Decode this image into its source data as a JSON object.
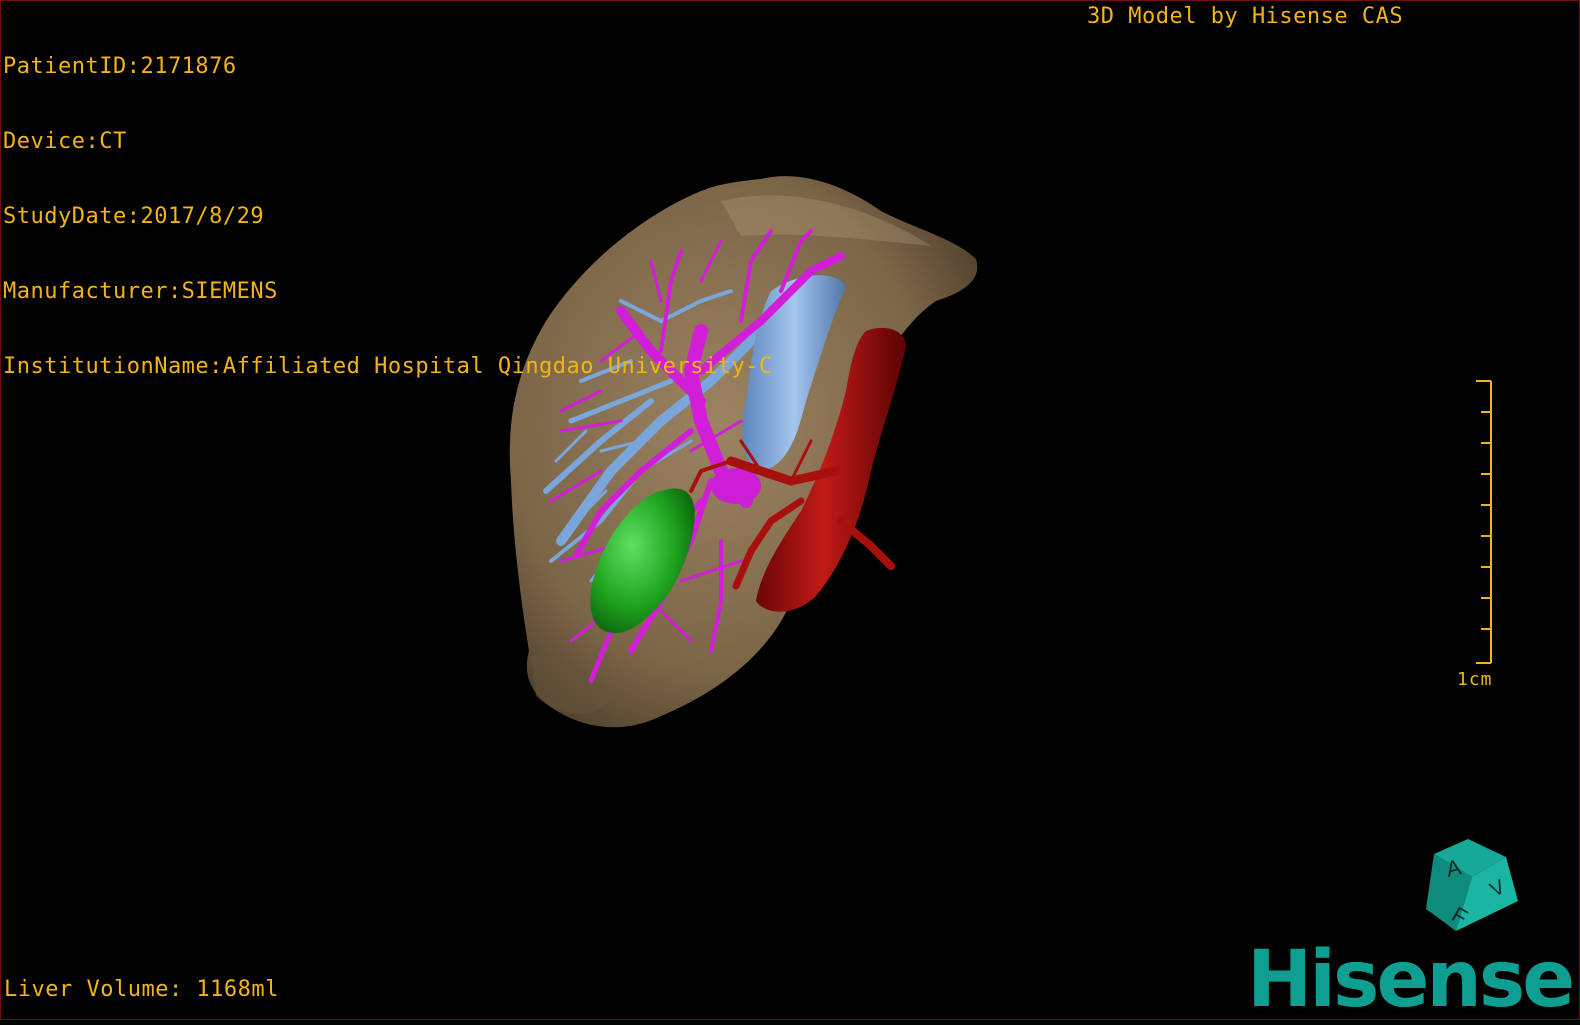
{
  "header": {
    "patient_id": "PatientID:2171876",
    "device": "Device:CT",
    "study_date": "StudyDate:2017/8/29",
    "manufacturer": "Manufacturer:SIEMENS",
    "institution": "InstitutionName:Affiliated Hospital Qingdao University-C"
  },
  "title": "3D Model by Hisense CAS",
  "footer": {
    "liver_volume": "Liver Volume: 1168ml"
  },
  "scale_bar": {
    "label": "1cm"
  },
  "orientation_cube": {
    "faces": [
      "A",
      "F",
      "V"
    ]
  },
  "logo": {
    "text": "Hisense"
  },
  "colors": {
    "overlay_text": "#f2b418",
    "liver": "#8a7355",
    "hepatic_vein": "#7aa6dc",
    "portal_vein": "#d21ed8",
    "artery": "#a8100e",
    "lesion": "#1e9a1e",
    "brand": "#0e9f92"
  },
  "icons": [
    "orientation-cube-icon",
    "scale-bar-icon",
    "hisense-logo"
  ]
}
